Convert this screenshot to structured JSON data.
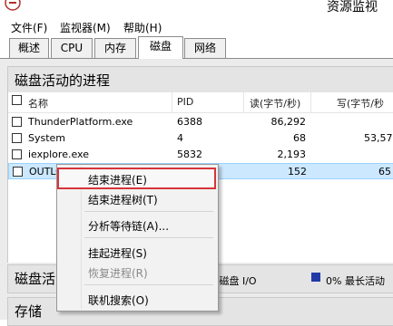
{
  "window": {
    "title": "资源监视"
  },
  "menu": {
    "file": "文件(F)",
    "monitor": "监视器(M)",
    "help": "帮助(H)"
  },
  "tabs": [
    "概述",
    "CPU",
    "内存",
    "磁盘",
    "网络"
  ],
  "active_tab": "磁盘",
  "processes_section": {
    "title": "磁盘活动的进程",
    "columns": {
      "name": "名称",
      "pid": "PID",
      "read": "读(字节/秒)",
      "write": "写(字节/秒"
    },
    "rows": [
      {
        "name": "ThunderPlatform.exe",
        "pid": "6388",
        "read": "86,292",
        "write": ""
      },
      {
        "name": "System",
        "pid": "4",
        "read": "68",
        "write": "53,57"
      },
      {
        "name": "iexplore.exe",
        "pid": "5832",
        "read": "2,193",
        "write": ""
      },
      {
        "name": "OUTLO",
        "pid": "",
        "read": "152",
        "write": "65"
      }
    ]
  },
  "disk_activity_section": {
    "title": "磁盘活",
    "io_text": "%磁盘 I/O",
    "max_active_text": "0% 最长活动",
    "legend_color": "#1f3aa8"
  },
  "storage_section": {
    "title": "存储"
  },
  "context_menu": {
    "items": [
      {
        "label": "结束进程(E)",
        "highlighted": true,
        "disabled": false
      },
      {
        "label": "结束进程树(T)",
        "highlighted": false,
        "disabled": false
      },
      {
        "label": "分析等待链(A)...",
        "highlighted": false,
        "disabled": false
      },
      {
        "label": "挂起进程(S)",
        "highlighted": false,
        "disabled": false
      },
      {
        "label": "恢复进程(R)",
        "highlighted": false,
        "disabled": true
      },
      {
        "label": "联机搜索(O)",
        "highlighted": false,
        "disabled": false
      }
    ]
  }
}
